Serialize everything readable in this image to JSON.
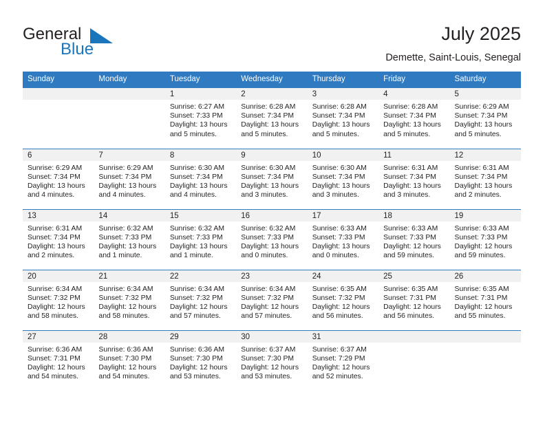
{
  "brand": {
    "name_part1": "General",
    "name_part2": "Blue",
    "logo_icon": "triangle-flag-icon",
    "accent_color": "#1b75bb"
  },
  "header": {
    "title": "July 2025",
    "subtitle": "Demette, Saint-Louis, Senegal"
  },
  "theme": {
    "header_row_bg": "#2f7ac0",
    "daynum_bg": "#f1f1f1",
    "text_color": "#231f20"
  },
  "calendar": {
    "weekday_headers": [
      "Sunday",
      "Monday",
      "Tuesday",
      "Wednesday",
      "Thursday",
      "Friday",
      "Saturday"
    ],
    "weeks": [
      [
        {
          "day": "",
          "blank": true,
          "sunrise": "",
          "sunset": "",
          "daylight_line1": "",
          "daylight_line2": ""
        },
        {
          "day": "",
          "blank": true,
          "sunrise": "",
          "sunset": "",
          "daylight_line1": "",
          "daylight_line2": ""
        },
        {
          "day": "1",
          "sunrise": "Sunrise: 6:27 AM",
          "sunset": "Sunset: 7:33 PM",
          "daylight_line1": "Daylight: 13 hours",
          "daylight_line2": "and 5 minutes."
        },
        {
          "day": "2",
          "sunrise": "Sunrise: 6:28 AM",
          "sunset": "Sunset: 7:34 PM",
          "daylight_line1": "Daylight: 13 hours",
          "daylight_line2": "and 5 minutes."
        },
        {
          "day": "3",
          "sunrise": "Sunrise: 6:28 AM",
          "sunset": "Sunset: 7:34 PM",
          "daylight_line1": "Daylight: 13 hours",
          "daylight_line2": "and 5 minutes."
        },
        {
          "day": "4",
          "sunrise": "Sunrise: 6:28 AM",
          "sunset": "Sunset: 7:34 PM",
          "daylight_line1": "Daylight: 13 hours",
          "daylight_line2": "and 5 minutes."
        },
        {
          "day": "5",
          "sunrise": "Sunrise: 6:29 AM",
          "sunset": "Sunset: 7:34 PM",
          "daylight_line1": "Daylight: 13 hours",
          "daylight_line2": "and 5 minutes."
        }
      ],
      [
        {
          "day": "6",
          "sunrise": "Sunrise: 6:29 AM",
          "sunset": "Sunset: 7:34 PM",
          "daylight_line1": "Daylight: 13 hours",
          "daylight_line2": "and 4 minutes."
        },
        {
          "day": "7",
          "sunrise": "Sunrise: 6:29 AM",
          "sunset": "Sunset: 7:34 PM",
          "daylight_line1": "Daylight: 13 hours",
          "daylight_line2": "and 4 minutes."
        },
        {
          "day": "8",
          "sunrise": "Sunrise: 6:30 AM",
          "sunset": "Sunset: 7:34 PM",
          "daylight_line1": "Daylight: 13 hours",
          "daylight_line2": "and 4 minutes."
        },
        {
          "day": "9",
          "sunrise": "Sunrise: 6:30 AM",
          "sunset": "Sunset: 7:34 PM",
          "daylight_line1": "Daylight: 13 hours",
          "daylight_line2": "and 3 minutes."
        },
        {
          "day": "10",
          "sunrise": "Sunrise: 6:30 AM",
          "sunset": "Sunset: 7:34 PM",
          "daylight_line1": "Daylight: 13 hours",
          "daylight_line2": "and 3 minutes."
        },
        {
          "day": "11",
          "sunrise": "Sunrise: 6:31 AM",
          "sunset": "Sunset: 7:34 PM",
          "daylight_line1": "Daylight: 13 hours",
          "daylight_line2": "and 3 minutes."
        },
        {
          "day": "12",
          "sunrise": "Sunrise: 6:31 AM",
          "sunset": "Sunset: 7:34 PM",
          "daylight_line1": "Daylight: 13 hours",
          "daylight_line2": "and 2 minutes."
        }
      ],
      [
        {
          "day": "13",
          "sunrise": "Sunrise: 6:31 AM",
          "sunset": "Sunset: 7:34 PM",
          "daylight_line1": "Daylight: 13 hours",
          "daylight_line2": "and 2 minutes."
        },
        {
          "day": "14",
          "sunrise": "Sunrise: 6:32 AM",
          "sunset": "Sunset: 7:33 PM",
          "daylight_line1": "Daylight: 13 hours",
          "daylight_line2": "and 1 minute."
        },
        {
          "day": "15",
          "sunrise": "Sunrise: 6:32 AM",
          "sunset": "Sunset: 7:33 PM",
          "daylight_line1": "Daylight: 13 hours",
          "daylight_line2": "and 1 minute."
        },
        {
          "day": "16",
          "sunrise": "Sunrise: 6:32 AM",
          "sunset": "Sunset: 7:33 PM",
          "daylight_line1": "Daylight: 13 hours",
          "daylight_line2": "and 0 minutes."
        },
        {
          "day": "17",
          "sunrise": "Sunrise: 6:33 AM",
          "sunset": "Sunset: 7:33 PM",
          "daylight_line1": "Daylight: 13 hours",
          "daylight_line2": "and 0 minutes."
        },
        {
          "day": "18",
          "sunrise": "Sunrise: 6:33 AM",
          "sunset": "Sunset: 7:33 PM",
          "daylight_line1": "Daylight: 12 hours",
          "daylight_line2": "and 59 minutes."
        },
        {
          "day": "19",
          "sunrise": "Sunrise: 6:33 AM",
          "sunset": "Sunset: 7:33 PM",
          "daylight_line1": "Daylight: 12 hours",
          "daylight_line2": "and 59 minutes."
        }
      ],
      [
        {
          "day": "20",
          "sunrise": "Sunrise: 6:34 AM",
          "sunset": "Sunset: 7:32 PM",
          "daylight_line1": "Daylight: 12 hours",
          "daylight_line2": "and 58 minutes."
        },
        {
          "day": "21",
          "sunrise": "Sunrise: 6:34 AM",
          "sunset": "Sunset: 7:32 PM",
          "daylight_line1": "Daylight: 12 hours",
          "daylight_line2": "and 58 minutes."
        },
        {
          "day": "22",
          "sunrise": "Sunrise: 6:34 AM",
          "sunset": "Sunset: 7:32 PM",
          "daylight_line1": "Daylight: 12 hours",
          "daylight_line2": "and 57 minutes."
        },
        {
          "day": "23",
          "sunrise": "Sunrise: 6:34 AM",
          "sunset": "Sunset: 7:32 PM",
          "daylight_line1": "Daylight: 12 hours",
          "daylight_line2": "and 57 minutes."
        },
        {
          "day": "24",
          "sunrise": "Sunrise: 6:35 AM",
          "sunset": "Sunset: 7:32 PM",
          "daylight_line1": "Daylight: 12 hours",
          "daylight_line2": "and 56 minutes."
        },
        {
          "day": "25",
          "sunrise": "Sunrise: 6:35 AM",
          "sunset": "Sunset: 7:31 PM",
          "daylight_line1": "Daylight: 12 hours",
          "daylight_line2": "and 56 minutes."
        },
        {
          "day": "26",
          "sunrise": "Sunrise: 6:35 AM",
          "sunset": "Sunset: 7:31 PM",
          "daylight_line1": "Daylight: 12 hours",
          "daylight_line2": "and 55 minutes."
        }
      ],
      [
        {
          "day": "27",
          "sunrise": "Sunrise: 6:36 AM",
          "sunset": "Sunset: 7:31 PM",
          "daylight_line1": "Daylight: 12 hours",
          "daylight_line2": "and 54 minutes."
        },
        {
          "day": "28",
          "sunrise": "Sunrise: 6:36 AM",
          "sunset": "Sunset: 7:30 PM",
          "daylight_line1": "Daylight: 12 hours",
          "daylight_line2": "and 54 minutes."
        },
        {
          "day": "29",
          "sunrise": "Sunrise: 6:36 AM",
          "sunset": "Sunset: 7:30 PM",
          "daylight_line1": "Daylight: 12 hours",
          "daylight_line2": "and 53 minutes."
        },
        {
          "day": "30",
          "sunrise": "Sunrise: 6:37 AM",
          "sunset": "Sunset: 7:30 PM",
          "daylight_line1": "Daylight: 12 hours",
          "daylight_line2": "and 53 minutes."
        },
        {
          "day": "31",
          "sunrise": "Sunrise: 6:37 AM",
          "sunset": "Sunset: 7:29 PM",
          "daylight_line1": "Daylight: 12 hours",
          "daylight_line2": "and 52 minutes."
        },
        {
          "day": "",
          "blank": true,
          "sunrise": "",
          "sunset": "",
          "daylight_line1": "",
          "daylight_line2": ""
        },
        {
          "day": "",
          "blank": true,
          "sunrise": "",
          "sunset": "",
          "daylight_line1": "",
          "daylight_line2": ""
        }
      ]
    ]
  }
}
